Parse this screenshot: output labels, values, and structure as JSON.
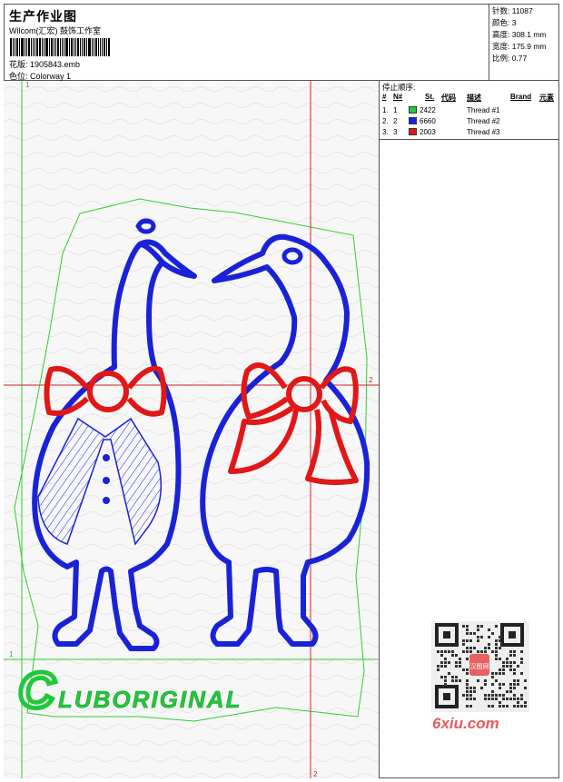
{
  "header": {
    "title": "生产作业图",
    "company": "Wilcom(汇宏) 鼓饰工作室",
    "design_file": "花版: 1905843.emb",
    "colorway": "色位: Colorway 1"
  },
  "stats": {
    "stitches": "针数: 11087",
    "colors": "颜色: 3",
    "height": "高度: 308.1 mm",
    "width": "宽度: 175.9 mm",
    "scale": "比例: 0.77"
  },
  "stop_sequence": {
    "title": "停止顺序:",
    "columns": {
      "num": "#",
      "n": "N#",
      "st": "St.",
      "code": "代码",
      "desc": "描述",
      "brand": "Brand",
      "element": "元素"
    },
    "rows": [
      {
        "num": "1.",
        "n": "1",
        "code": "2422",
        "desc": "Thread #1",
        "color": "#22c83c"
      },
      {
        "num": "2.",
        "n": "2",
        "code": "6660",
        "desc": "Thread #2",
        "color": "#1a22d8"
      },
      {
        "num": "3.",
        "n": "3",
        "code": "2003",
        "desc": "Thread #3",
        "color": "#e01818"
      }
    ]
  },
  "canvas": {
    "guide_labels": {
      "v_top": "1",
      "h_left": "1",
      "h_right": "2",
      "v_bottom": "2"
    },
    "logo_text": "CLUBORIGINAL",
    "thread_colors": {
      "green": "#22c83c",
      "blue": "#1a22d8",
      "red": "#e01818",
      "guide_green": "#33cc33",
      "guide_red": "#dd2222"
    }
  },
  "watermark": {
    "site": "6xiu.com",
    "qr_caption": "汉图网"
  }
}
